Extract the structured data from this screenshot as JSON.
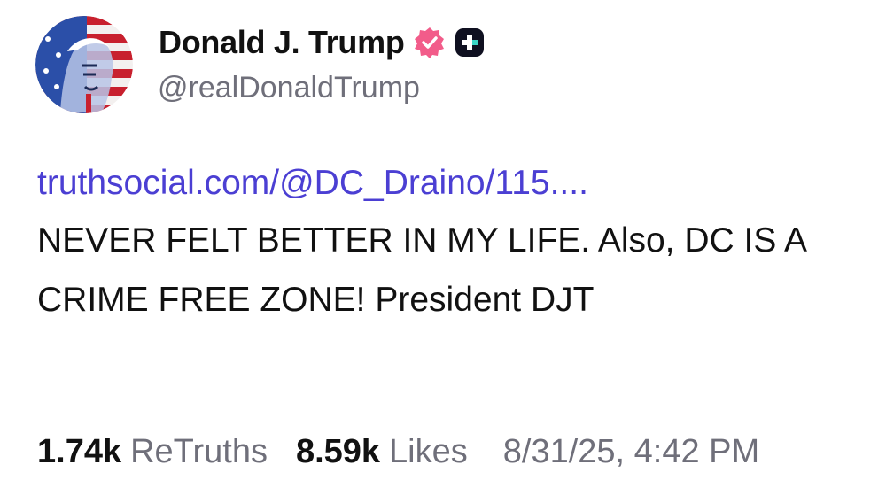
{
  "author": {
    "display_name": "Donald J. Trump",
    "handle": "@realDonaldTrump",
    "avatar_icon": "flag-portrait-avatar",
    "verified_icon": "verified-badge-icon",
    "app_icon": "truth-plus-badge-icon"
  },
  "post": {
    "link_text": "truthsocial.com/@DC_Draino/115....",
    "text": "NEVER FELT BETTER IN MY LIFE. Also, DC IS A CRIME FREE ZONE! President DJT"
  },
  "stats": {
    "retruths_count": "1.74k",
    "retruths_label": "ReTruths",
    "likes_count": "8.59k",
    "likes_label": "Likes",
    "timestamp": "8/31/25, 4:42 PM"
  },
  "colors": {
    "link": "#4b3fd3",
    "verified": "#f25c8a",
    "muted": "#6f6f7a",
    "text": "#111111"
  }
}
